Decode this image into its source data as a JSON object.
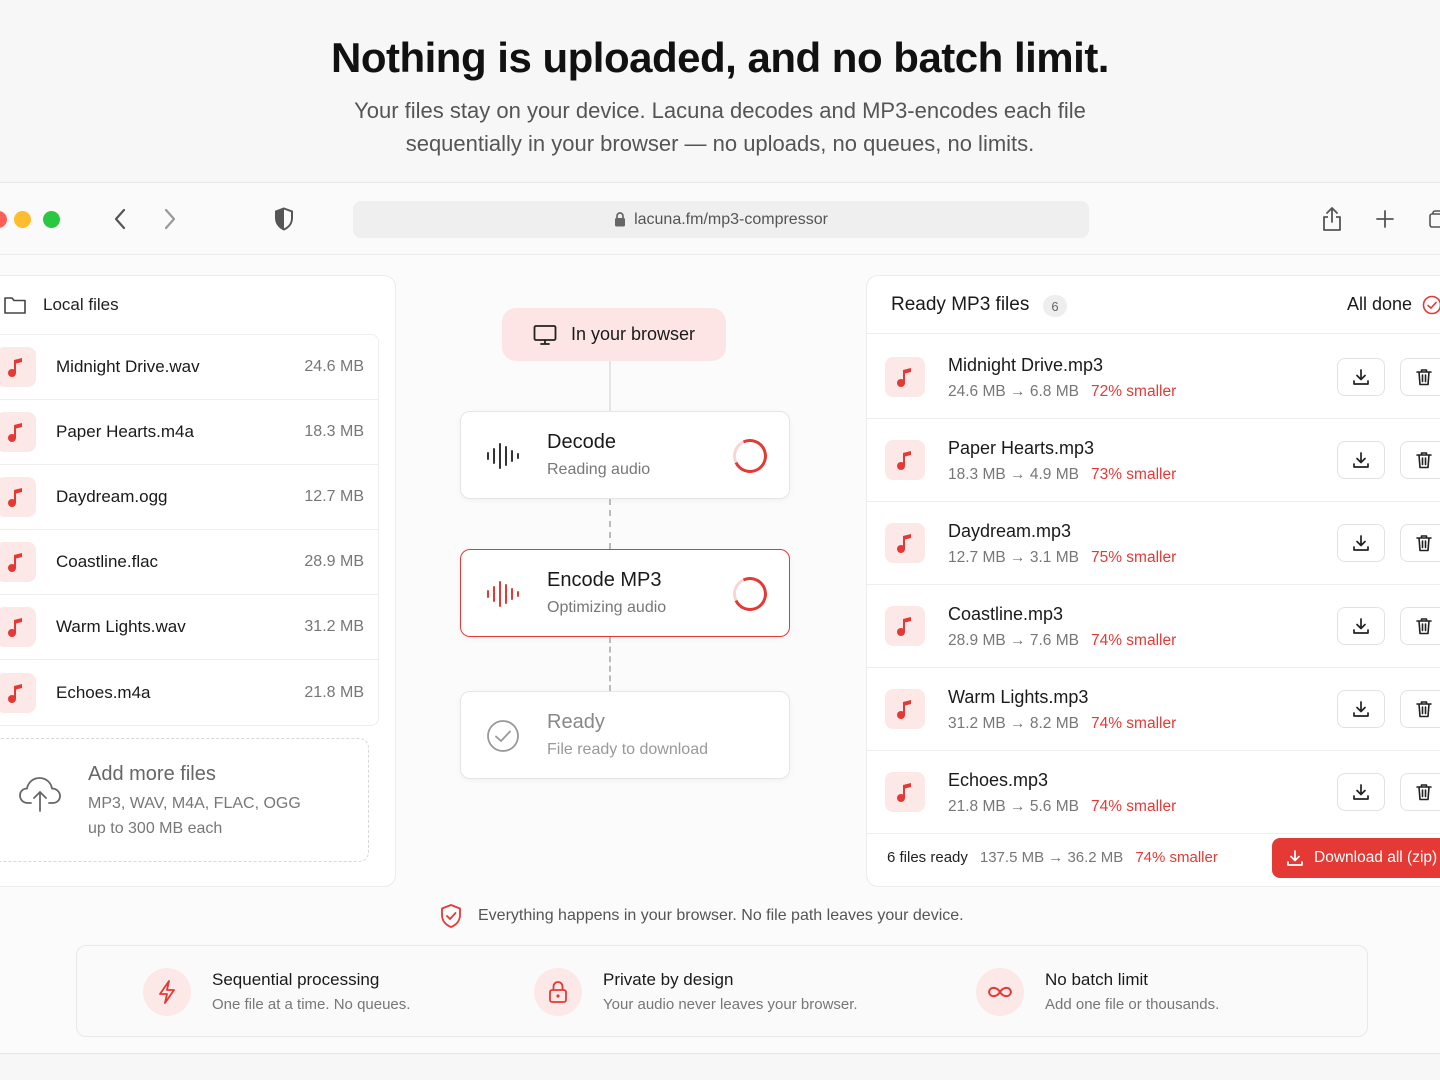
{
  "hero": {
    "title": "Nothing is uploaded, and no batch limit.",
    "subtitle_line1": "Your files stay on your device. Lacuna decodes and MP3-encodes each file",
    "subtitle_line2": "sequentially in your browser — no uploads, no queues, no limits."
  },
  "browser": {
    "url": "lacuna.fm/mp3-compressor"
  },
  "local_files": {
    "title": "Local files",
    "files": [
      {
        "name": "Midnight Drive.wav",
        "size": "24.6 MB"
      },
      {
        "name": "Paper Hearts.m4a",
        "size": "18.3 MB"
      },
      {
        "name": "Daydream.ogg",
        "size": "12.7 MB"
      },
      {
        "name": "Coastline.flac",
        "size": "28.9 MB"
      },
      {
        "name": "Warm Lights.wav",
        "size": "31.2 MB"
      },
      {
        "name": "Echoes.m4a",
        "size": "21.8 MB"
      }
    ],
    "add_title": "Add more files",
    "add_formats": "MP3, WAV, M4A, FLAC, OGG",
    "add_limit": "up to 300 MB each"
  },
  "pipeline": {
    "pill": "In your browser",
    "steps": [
      {
        "title": "Decode",
        "sub": "Reading audio"
      },
      {
        "title": "Encode MP3",
        "sub": "Optimizing audio"
      },
      {
        "title": "Ready",
        "sub": "File ready to download"
      }
    ]
  },
  "ready": {
    "title": "Ready MP3 files",
    "count": "6",
    "status": "All done",
    "files": [
      {
        "name": "Midnight Drive.mp3",
        "from": "24.6 MB",
        "to": "6.8 MB",
        "saving": "72% smaller"
      },
      {
        "name": "Paper Hearts.mp3",
        "from": "18.3 MB",
        "to": "4.9 MB",
        "saving": "73% smaller"
      },
      {
        "name": "Daydream.mp3",
        "from": "12.7 MB",
        "to": "3.1 MB",
        "saving": "75% smaller"
      },
      {
        "name": "Coastline.mp3",
        "from": "28.9 MB",
        "to": "7.6 MB",
        "saving": "74% smaller"
      },
      {
        "name": "Warm Lights.mp3",
        "from": "31.2 MB",
        "to": "8.2 MB",
        "saving": "74% smaller"
      },
      {
        "name": "Echoes.mp3",
        "from": "21.8 MB",
        "to": "5.6 MB",
        "saving": "74% smaller"
      }
    ],
    "footer_count": "6 files ready",
    "footer_from": "137.5 MB",
    "footer_to": "36.2 MB",
    "footer_saving": "74% smaller",
    "download_all": "Download all (zip)"
  },
  "privacy_note": "Everything happens in your browser. No file path leaves your device.",
  "features": [
    {
      "title": "Sequential processing",
      "sub": "One file at a time. No queues."
    },
    {
      "title": "Private by design",
      "sub": "Your audio never leaves your browser."
    },
    {
      "title": "No batch limit",
      "sub": "Add one file or thousands."
    }
  ],
  "colors": {
    "accent": "#e53935",
    "accent_soft": "#fde8e8"
  }
}
